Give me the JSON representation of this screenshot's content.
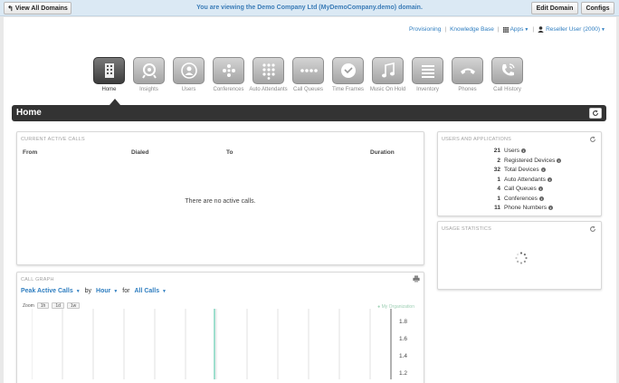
{
  "topbar": {
    "view_all_label": "View All Domains",
    "message": "You are viewing the Demo Company Ltd (MyDemoCompany.demo) domain.",
    "edit_domain_label": "Edit Domain",
    "configs_label": "Configs"
  },
  "header_links": {
    "provisioning": "Provisioning",
    "knowledge_base": "Knowledge Base",
    "apps": "Apps",
    "user": "Reseller User (2000)"
  },
  "nav": {
    "items": [
      {
        "label": "Home",
        "icon": "building-icon"
      },
      {
        "label": "Insights",
        "icon": "insights-icon"
      },
      {
        "label": "Users",
        "icon": "users-icon"
      },
      {
        "label": "Conferences",
        "icon": "conferences-icon"
      },
      {
        "label": "Auto Attendants",
        "icon": "keypad-icon"
      },
      {
        "label": "Call Queues",
        "icon": "queue-icon"
      },
      {
        "label": "Time Frames",
        "icon": "clock-icon"
      },
      {
        "label": "Music On Hold",
        "icon": "music-icon"
      },
      {
        "label": "Inventory",
        "icon": "list-icon"
      },
      {
        "label": "Phones",
        "icon": "phone-icon"
      },
      {
        "label": "Call History",
        "icon": "call-history-icon"
      }
    ],
    "active_index": 0
  },
  "page_title": "Home",
  "active_calls": {
    "heading": "CURRENT ACTIVE CALLS",
    "columns": [
      "From",
      "Dialed",
      "To",
      "Duration"
    ],
    "empty_message": "There are no active calls."
  },
  "users_apps": {
    "heading": "USERS AND APPLICATIONS",
    "rows": [
      {
        "count": "21",
        "label": "Users"
      },
      {
        "count": "2",
        "label": "Registered Devices"
      },
      {
        "count": "32",
        "label": "Total Devices"
      },
      {
        "count": "1",
        "label": "Auto Attendants"
      },
      {
        "count": "4",
        "label": "Call Queues"
      },
      {
        "count": "1",
        "label": "Conferences"
      },
      {
        "count": "11",
        "label": "Phone Numbers"
      }
    ]
  },
  "usage": {
    "heading": "USAGE STATISTICS"
  },
  "call_graph": {
    "heading": "CALL GRAPH",
    "metric": "Peak Active Calls",
    "by_word": "by",
    "interval": "Hour",
    "for_word": "for",
    "filter": "All Calls",
    "zoom_label": "Zoom",
    "zoom_options": [
      "1h",
      "1d",
      "1w"
    ],
    "legend": "My Organization",
    "y_ticks": [
      "1.8",
      "1.6",
      "1.4",
      "1.2"
    ],
    "line_color": "#7fd3bd"
  },
  "colors": {
    "link": "#2f7ec0",
    "title_bar": "#333333",
    "top_bar": "#dbe9f4"
  }
}
